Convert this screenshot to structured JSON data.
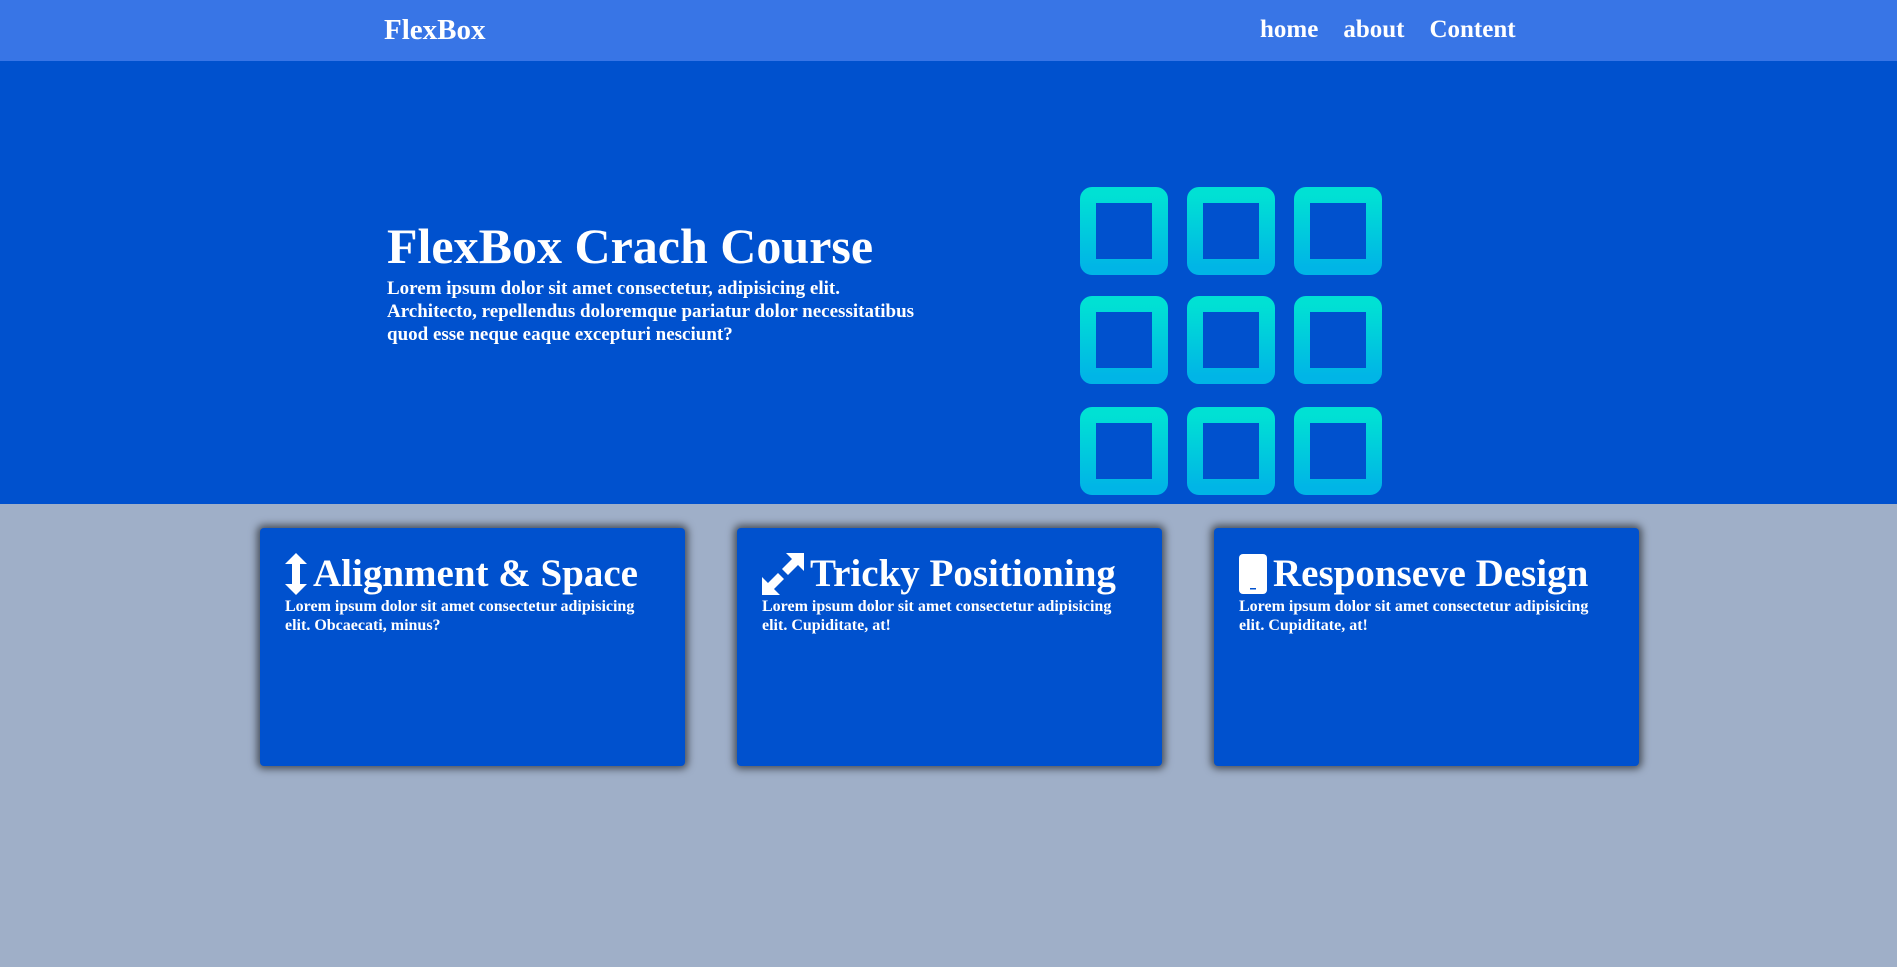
{
  "navbar": {
    "brand": "FlexBox",
    "links": [
      "home",
      "about",
      "Content"
    ],
    "background": "#3875e6"
  },
  "hero": {
    "title": "FlexBox Crach Course",
    "text": "Lorem ipsum dolor sit amet consectetur, adipisicing elit. Architecto, repellendus doloremque pariatur dolor necessitatibus quod esse neque eaque excepturi nesciunt?",
    "background": "#0051ce",
    "graphic_icon": "grid-3x3-icon",
    "graphic_gradient": [
      "#00e1d4",
      "#00b5e6"
    ]
  },
  "cards": [
    {
      "icon": "arrows-vertical-icon",
      "title": "Alignment & Space",
      "text": "Lorem ipsum dolor sit amet consectetur adipisicing elit. Obcaecati, minus?"
    },
    {
      "icon": "expand-diagonal-icon",
      "title": "Tricky Positioning",
      "text": "Lorem ipsum dolor sit amet consectetur adipisicing elit. Cupiditate, at!"
    },
    {
      "icon": "mobile-phone-icon",
      "title": "Responseve Design",
      "text": "Lorem ipsum dolor sit amet consectetur adipisicing elit. Cupiditate, at!"
    }
  ],
  "colors": {
    "page_background": "#9fafc8",
    "card_background": "#0051ce",
    "text": "#ffffff"
  }
}
